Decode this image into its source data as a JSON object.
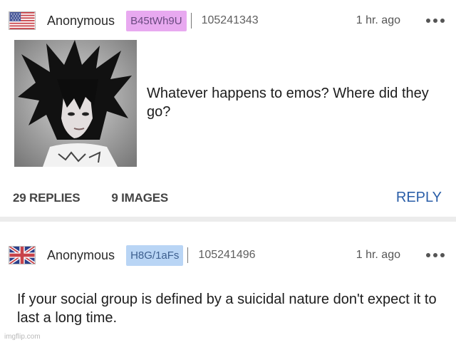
{
  "op": {
    "name": "Anonymous",
    "user_id": "B45tWh9U",
    "post_number": "105241343",
    "time": "1 hr. ago",
    "flag": "us-flag-icon",
    "text": "Whatever happens to emos? Where did they go?",
    "replies": "29 REPLIES",
    "images": "9 IMAGES",
    "reply_label": "REPLY",
    "id_color": "#e8a9f0"
  },
  "reply": {
    "name": "Anonymous",
    "user_id": "H8G/1aFs",
    "post_number": "105241496",
    "time": "1 hr. ago",
    "flag": "uk-flag-icon",
    "text": "If your social group is defined by a suicidal nature don't expect it to last a long time.",
    "id_color": "#b9d5f5"
  },
  "watermark": "imgflip.com",
  "colors": {
    "accent": "#2a5ea8"
  }
}
